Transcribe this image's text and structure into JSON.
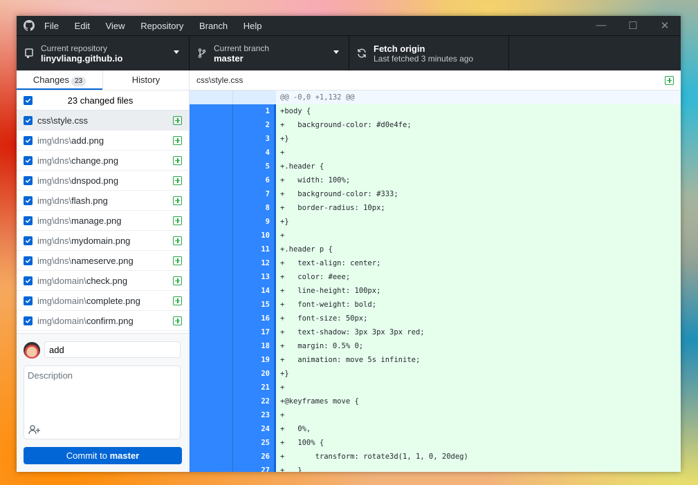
{
  "app": {
    "menu": [
      "File",
      "Edit",
      "View",
      "Repository",
      "Branch",
      "Help"
    ],
    "window_controls": [
      "minimize",
      "maximize",
      "close"
    ]
  },
  "toolbar": {
    "repo_label": "Current repository",
    "repo_value": "linyvliang.github.io",
    "branch_label": "Current branch",
    "branch_value": "master",
    "fetch_label": "Fetch origin",
    "fetch_sub": "Last fetched 3 minutes ago"
  },
  "sidebar": {
    "tabs": [
      {
        "label": "Changes",
        "count": "23"
      },
      {
        "label": "History"
      }
    ],
    "changed_files_label": "23 changed files",
    "files": [
      {
        "dim": "",
        "name": "css\\style.css"
      },
      {
        "dim": "img\\dns\\",
        "name": "add.png"
      },
      {
        "dim": "img\\dns\\",
        "name": "change.png"
      },
      {
        "dim": "img\\dns\\",
        "name": "dnspod.png"
      },
      {
        "dim": "img\\dns\\",
        "name": "flash.png"
      },
      {
        "dim": "img\\dns\\",
        "name": "manage.png"
      },
      {
        "dim": "img\\dns\\",
        "name": "mydomain.png"
      },
      {
        "dim": "img\\dns\\",
        "name": "nameserve.png"
      },
      {
        "dim": "img\\domain\\",
        "name": "check.png"
      },
      {
        "dim": "img\\domain\\",
        "name": "complete.png"
      },
      {
        "dim": "img\\domain\\",
        "name": "confirm.png"
      }
    ]
  },
  "commit": {
    "summary": "add",
    "description_placeholder": "Description",
    "button_prefix": "Commit to ",
    "button_branch": "master"
  },
  "diff": {
    "file_path": "css\\style.css",
    "hunk": "@@ -0,0 +1,132 @@",
    "lines": [
      {
        "n": "1",
        "t": "+body {"
      },
      {
        "n": "2",
        "t": "+   background-color: #d0e4fe;"
      },
      {
        "n": "3",
        "t": "+}"
      },
      {
        "n": "4",
        "t": "+"
      },
      {
        "n": "5",
        "t": "+.header {"
      },
      {
        "n": "6",
        "t": "+   width: 100%;"
      },
      {
        "n": "7",
        "t": "+   background-color: #333;"
      },
      {
        "n": "8",
        "t": "+   border-radius: 10px;"
      },
      {
        "n": "9",
        "t": "+}"
      },
      {
        "n": "10",
        "t": "+"
      },
      {
        "n": "11",
        "t": "+.header p {"
      },
      {
        "n": "12",
        "t": "+   text-align: center;"
      },
      {
        "n": "13",
        "t": "+   color: #eee;"
      },
      {
        "n": "14",
        "t": "+   line-height: 100px;"
      },
      {
        "n": "15",
        "t": "+   font-weight: bold;"
      },
      {
        "n": "16",
        "t": "+   font-size: 50px;"
      },
      {
        "n": "17",
        "t": "+   text-shadow: 3px 3px 3px red;"
      },
      {
        "n": "18",
        "t": "+   margin: 0.5% 0;"
      },
      {
        "n": "19",
        "t": "+   animation: move 5s infinite;"
      },
      {
        "n": "20",
        "t": "+}"
      },
      {
        "n": "21",
        "t": "+"
      },
      {
        "n": "22",
        "t": "+@keyframes move {"
      },
      {
        "n": "23",
        "t": "+"
      },
      {
        "n": "24",
        "t": "+   0%,"
      },
      {
        "n": "25",
        "t": "+   100% {"
      },
      {
        "n": "26",
        "t": "+       transform: rotate3d(1, 1, 0, 20deg)"
      },
      {
        "n": "27",
        "t": "+   }"
      }
    ]
  }
}
